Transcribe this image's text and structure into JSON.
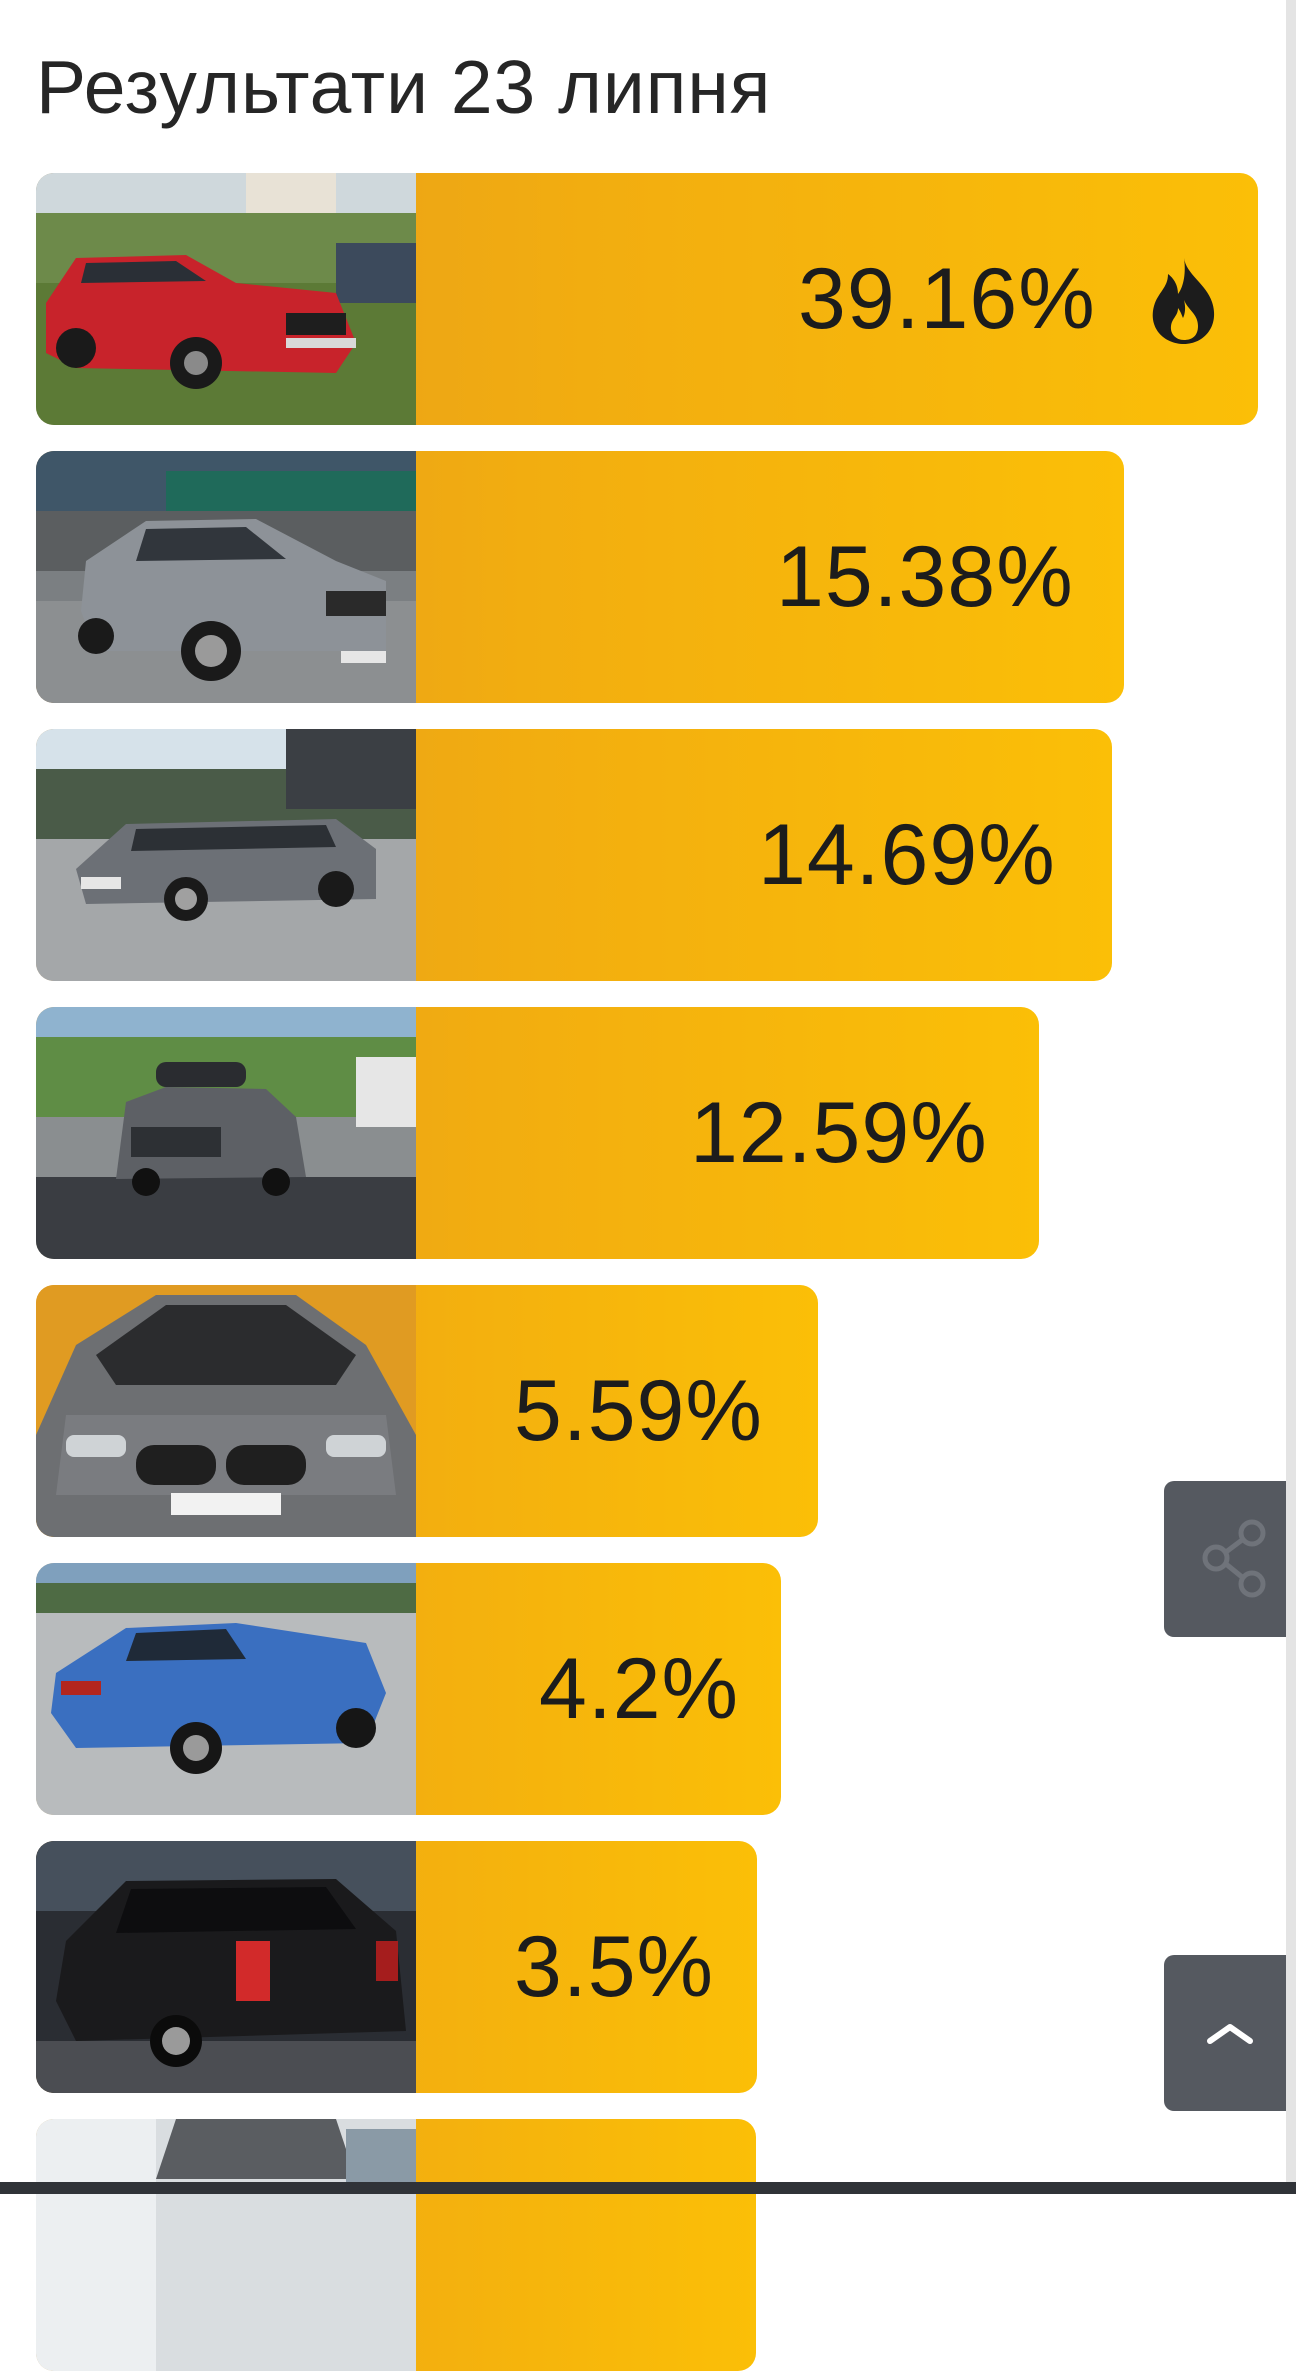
{
  "page": {
    "title": "Результати 23 липня"
  },
  "colors": {
    "bar_gradient_start": "#e39a1f",
    "bar_gradient_end": "#fbbf07",
    "side_button_bg": "#555960",
    "text": "#1c1c1c"
  },
  "results": [
    {
      "percent_label": "39.16%",
      "value": 39.16,
      "badge_icon": "fire-icon",
      "photo": "red-sedan-on-grass"
    },
    {
      "percent_label": "15.38%",
      "value": 15.38,
      "photo": "gray-sedan-in-lot"
    },
    {
      "percent_label": "14.69%",
      "value": 14.69,
      "photo": "gray-station-wagon"
    },
    {
      "percent_label": "12.59%",
      "value": 12.59,
      "photo": "gray-minivan-roof-box"
    },
    {
      "percent_label": "5.59%",
      "value": 5.59,
      "photo": "gray-bmw-open-hood"
    },
    {
      "percent_label": "4.2%",
      "value": 4.2,
      "photo": "blue-sedan"
    },
    {
      "percent_label": "3.5%",
      "value": 3.5,
      "photo": "dark-suv-at-night"
    },
    {
      "percent_label": "",
      "value": null,
      "photo": "car-in-garage-partial"
    }
  ],
  "controls": {
    "share_icon": "share-icon",
    "scroll_top_icon": "chevron-up-icon"
  }
}
